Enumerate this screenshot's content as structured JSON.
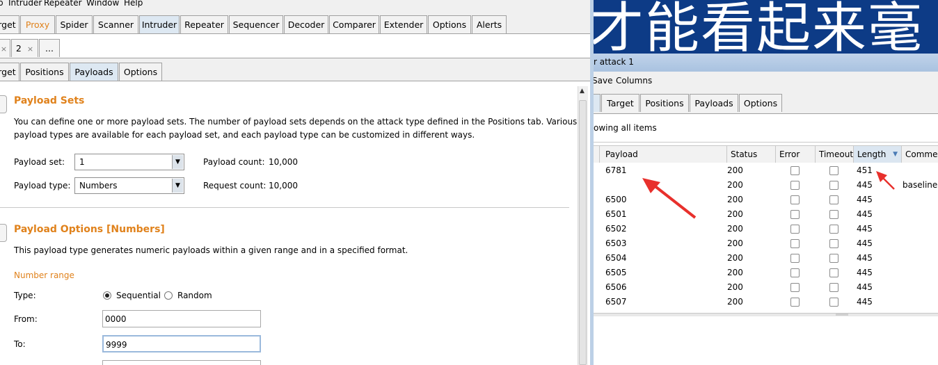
{
  "left": {
    "menu": [
      "p",
      "Intruder",
      "Repeater",
      "Window",
      "Help"
    ],
    "main_tabs": [
      "rget",
      "Proxy",
      "Spider",
      "Scanner",
      "Intruder",
      "Repeater",
      "Sequencer",
      "Decoder",
      "Comparer",
      "Extender",
      "Options",
      "Alerts"
    ],
    "attack_tabs": {
      "close1": "×",
      "tab2": "2",
      "close2": "×",
      "more": "..."
    },
    "sub_tabs": [
      "rget",
      "Positions",
      "Payloads",
      "Options"
    ],
    "payload_sets": {
      "title": "Payload Sets",
      "desc1": "You can define one or more payload sets. The number of payload sets depends on the attack type defined in the Positions tab. Various",
      "desc2": "payload types are available for each payload set, and each payload type can be customized in different ways.",
      "set_label": "Payload set:",
      "set_value": "1",
      "count_label": "Payload count:",
      "count_value": "10,000",
      "type_label": "Payload type:",
      "type_value": "Numbers",
      "request_label": "Request count:",
      "request_value": "10,000"
    },
    "payload_options": {
      "title": "Payload Options [Numbers]",
      "desc": "This payload type generates numeric payloads within a given range and in a specified format.",
      "range_heading": "Number range",
      "type_label": "Type:",
      "sequential": "Sequential",
      "random": "Random",
      "from_label": "From:",
      "from_value": "0000",
      "to_label": "To:",
      "to_value": "9999"
    }
  },
  "right": {
    "banner_text": "才能看起来毫",
    "window_title": "r attack 1",
    "menu": [
      "Save",
      "Columns"
    ],
    "tabs": [
      "Target",
      "Positions",
      "Payloads",
      "Options"
    ],
    "filter": "owing all items",
    "columns": [
      "Payload",
      "Status",
      "Error",
      "Timeout",
      "Length",
      "Commen"
    ],
    "rows": [
      {
        "payload": "6781",
        "status": "200",
        "length": "451",
        "comment": ""
      },
      {
        "payload": "",
        "status": "200",
        "length": "445",
        "comment": "baseline"
      },
      {
        "payload": "6500",
        "status": "200",
        "length": "445",
        "comment": ""
      },
      {
        "payload": "6501",
        "status": "200",
        "length": "445",
        "comment": ""
      },
      {
        "payload": "6502",
        "status": "200",
        "length": "445",
        "comment": ""
      },
      {
        "payload": "6503",
        "status": "200",
        "length": "445",
        "comment": ""
      },
      {
        "payload": "6504",
        "status": "200",
        "length": "445",
        "comment": ""
      },
      {
        "payload": "6505",
        "status": "200",
        "length": "445",
        "comment": ""
      },
      {
        "payload": "6506",
        "status": "200",
        "length": "445",
        "comment": ""
      },
      {
        "payload": "6507",
        "status": "200",
        "length": "445",
        "comment": ""
      }
    ]
  },
  "colors": {
    "accent_orange": "#e0821c",
    "banner_blue": "#0d3b86",
    "selected_tab": "#dde8f2",
    "annotation_red": "#e8302c"
  }
}
